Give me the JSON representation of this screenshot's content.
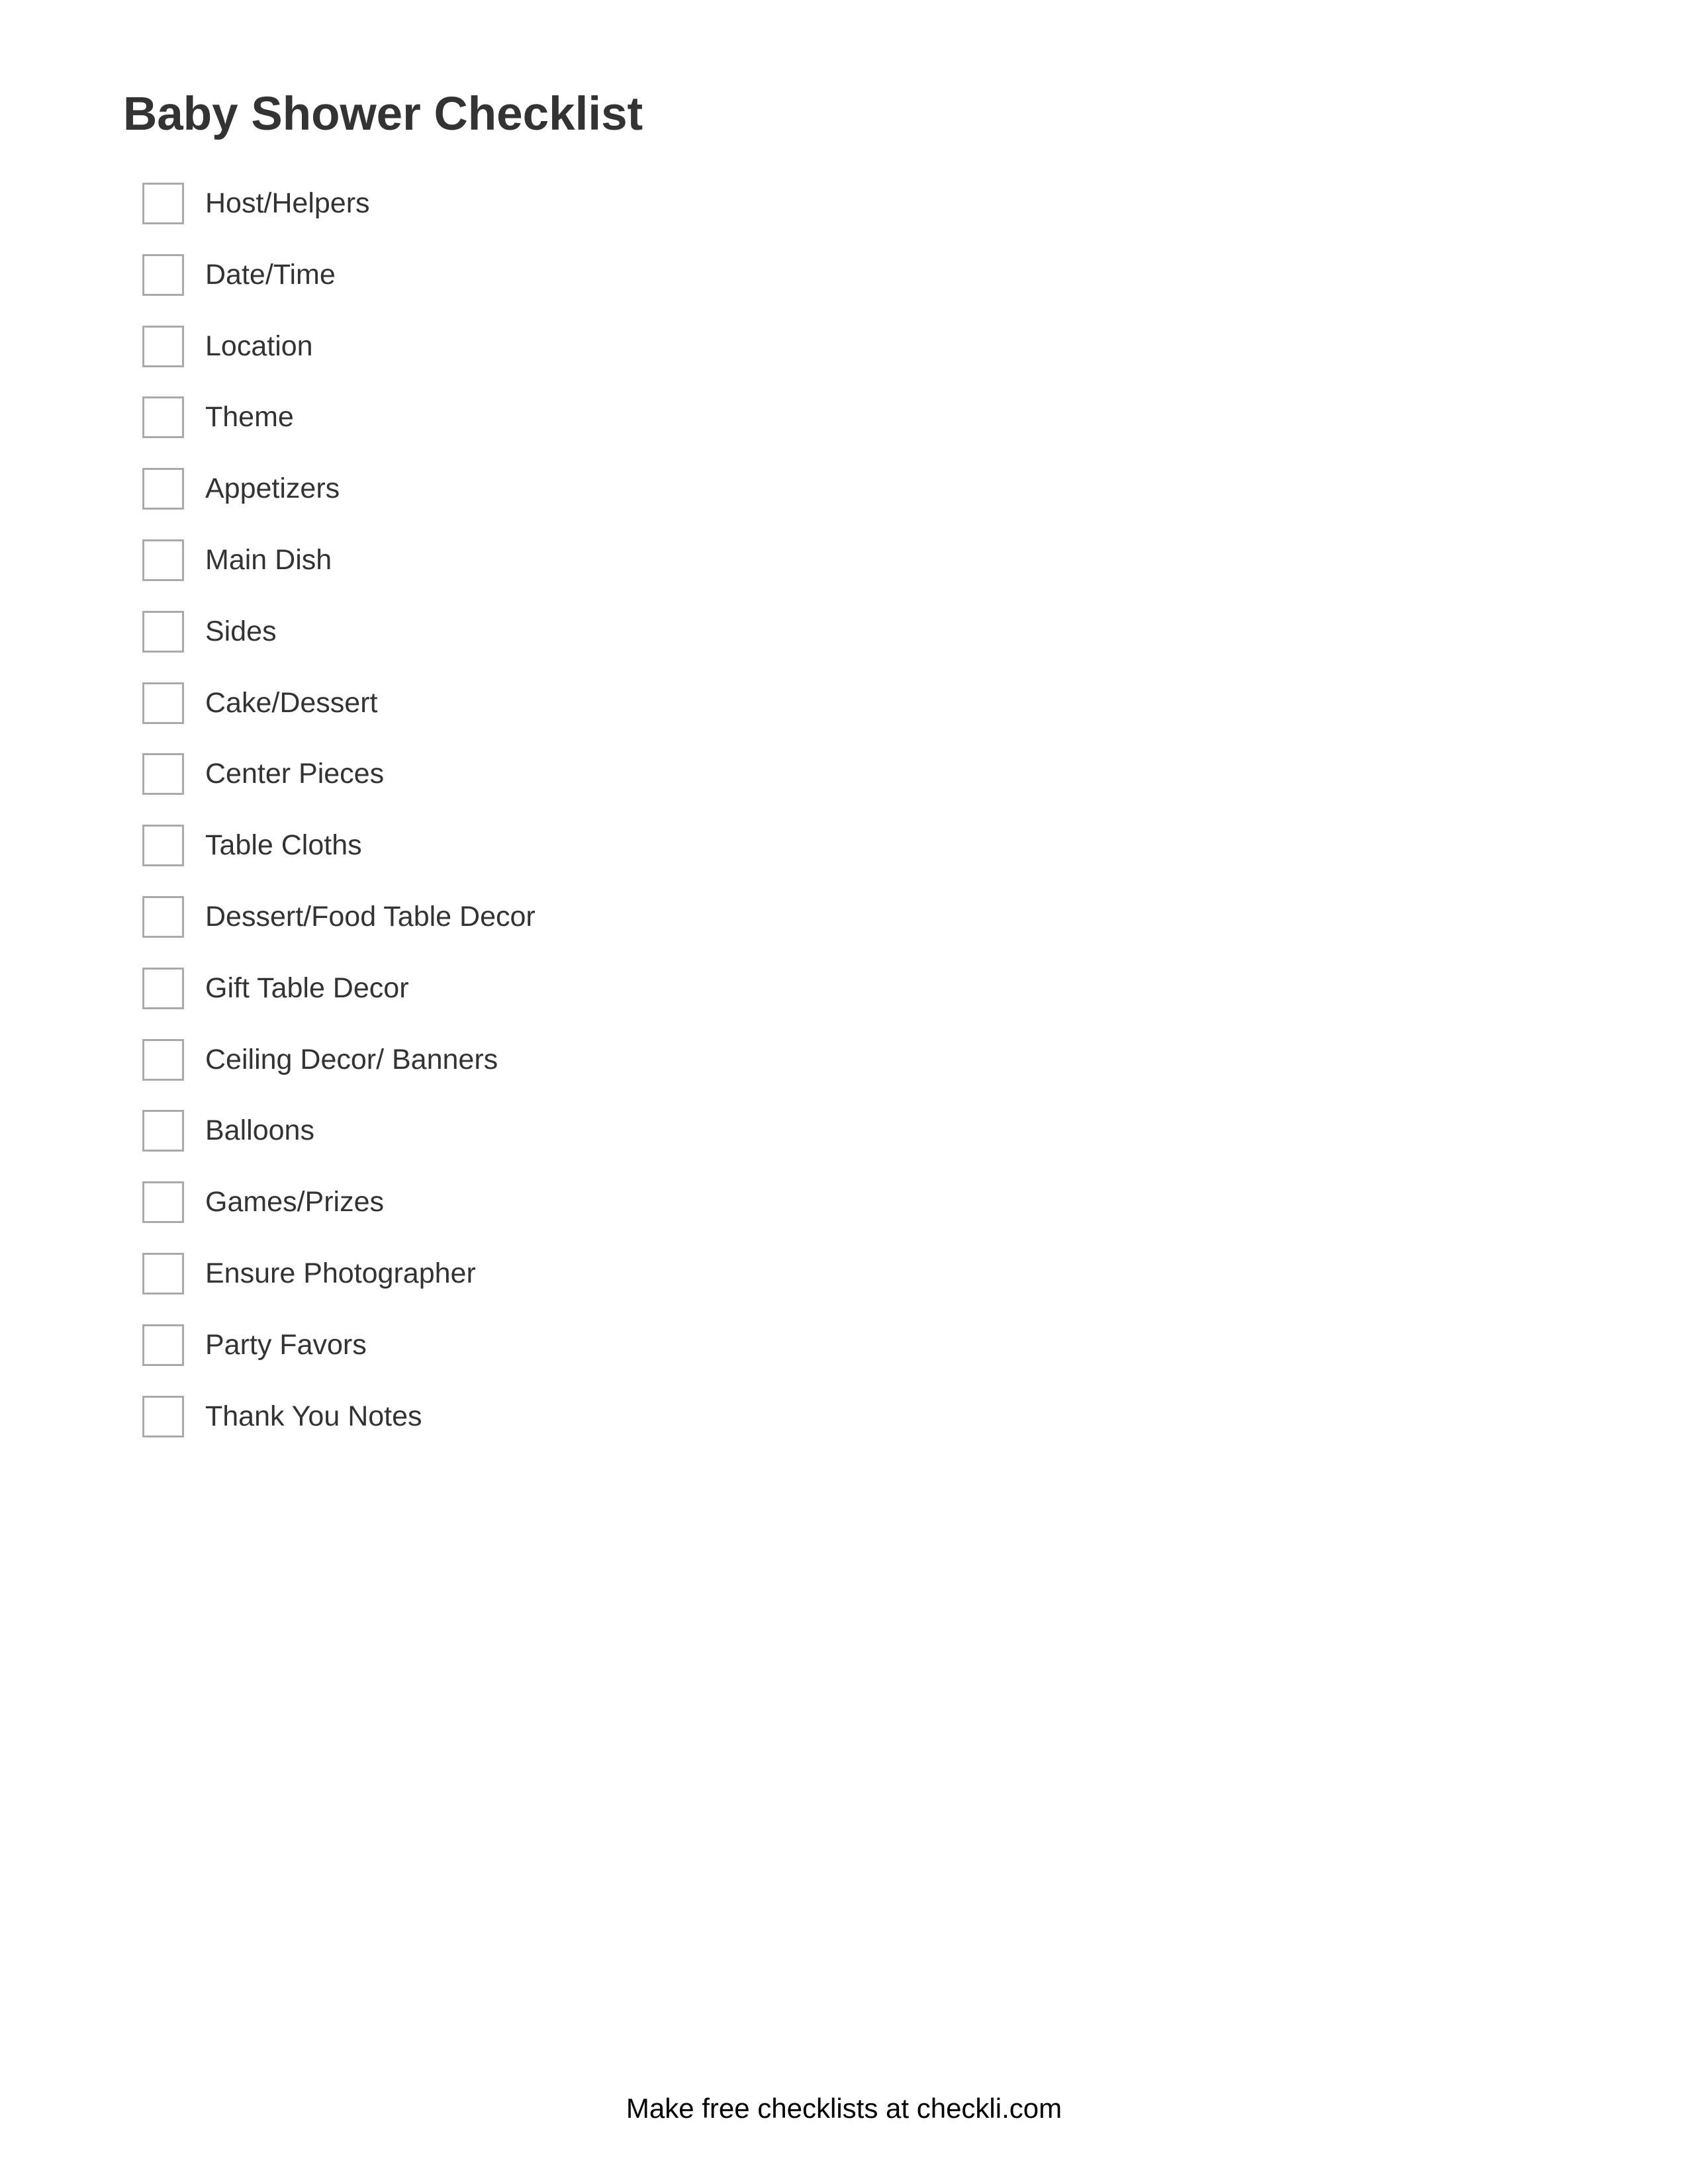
{
  "document": {
    "title": "Baby Shower Checklist",
    "items": [
      {
        "label": "Host/Helpers",
        "checked": false
      },
      {
        "label": "Date/Time",
        "checked": false
      },
      {
        "label": "Location",
        "checked": false
      },
      {
        "label": "Theme",
        "checked": false
      },
      {
        "label": "Appetizers",
        "checked": false
      },
      {
        "label": "Main Dish",
        "checked": false
      },
      {
        "label": "Sides",
        "checked": false
      },
      {
        "label": "Cake/Dessert",
        "checked": false
      },
      {
        "label": "Center Pieces",
        "checked": false
      },
      {
        "label": "Table Cloths",
        "checked": false
      },
      {
        "label": "Dessert/Food Table Decor",
        "checked": false
      },
      {
        "label": "Gift Table Decor",
        "checked": false
      },
      {
        "label": "Ceiling Decor/ Banners",
        "checked": false
      },
      {
        "label": "Balloons",
        "checked": false
      },
      {
        "label": "Games/Prizes",
        "checked": false
      },
      {
        "label": "Ensure Photographer",
        "checked": false
      },
      {
        "label": "Party Favors",
        "checked": false
      },
      {
        "label": "Thank You Notes",
        "checked": false
      }
    ],
    "footer": "Make free checklists at checkli.com"
  },
  "colors": {
    "text": "#333333",
    "checkbox_border": "#aaaaaa",
    "footer_text": "#000000",
    "background": "#ffffff"
  }
}
